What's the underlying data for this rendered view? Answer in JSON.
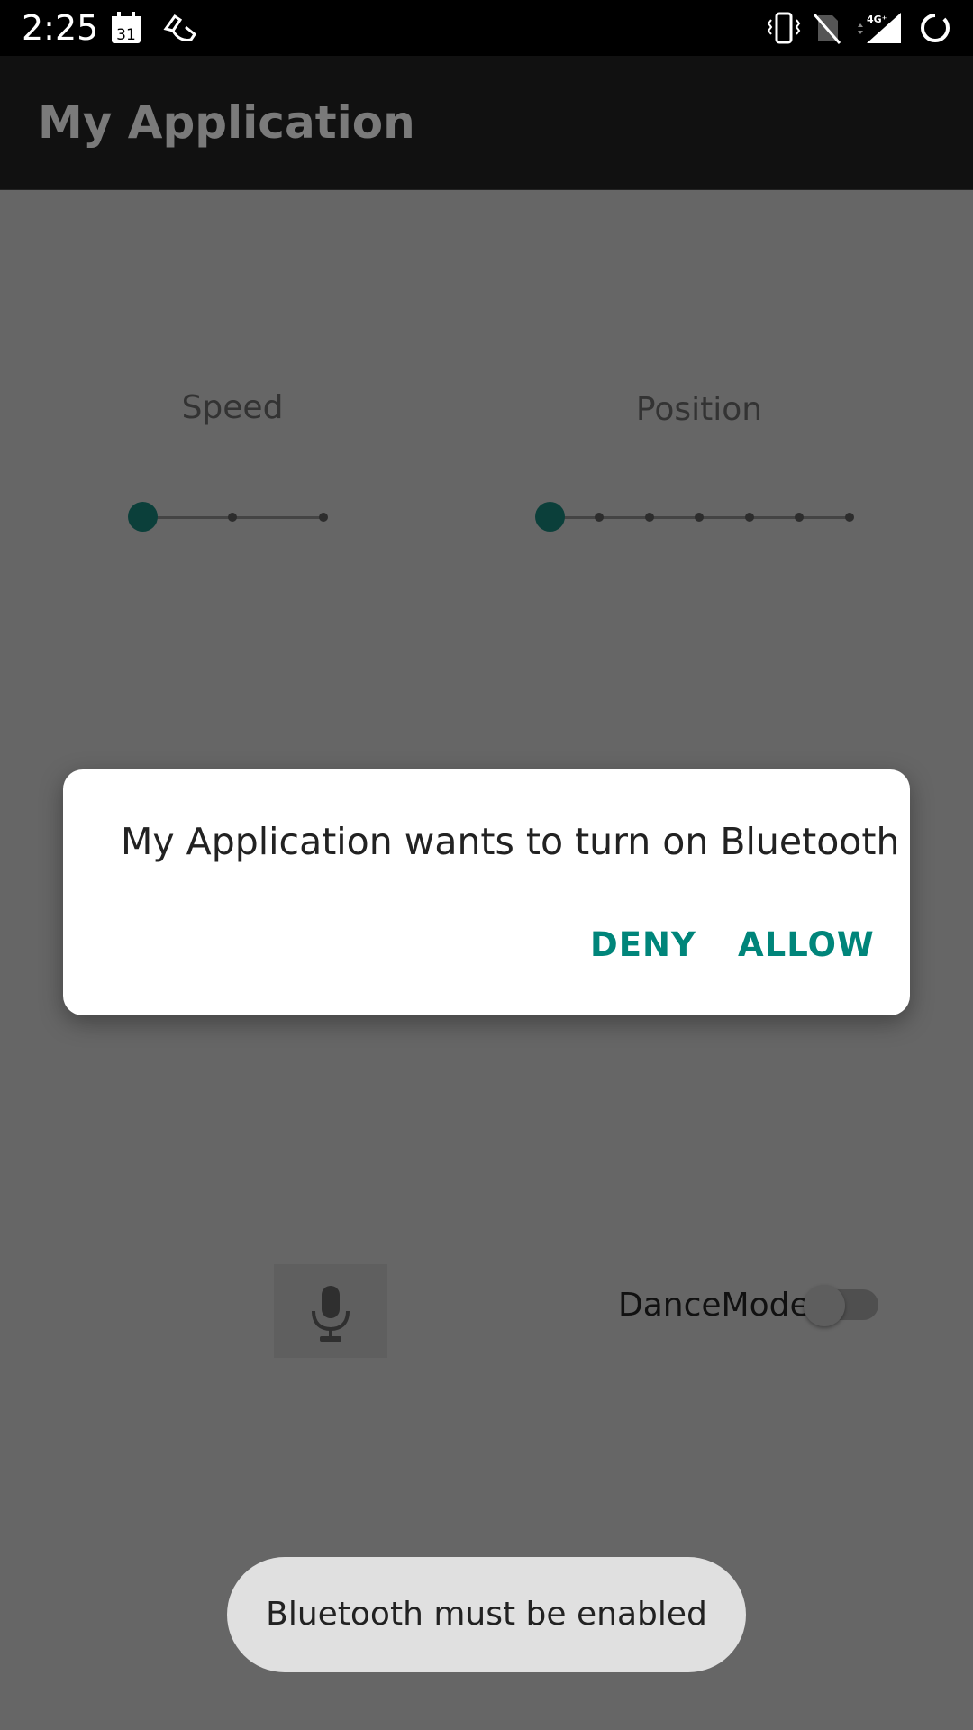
{
  "status_bar": {
    "time": "2:25",
    "calendar_day": "31",
    "network": "4G⁺"
  },
  "app_bar": {
    "title": "My Application"
  },
  "controls": {
    "speed": {
      "label": "Speed",
      "value": 0,
      "steps": 3
    },
    "position": {
      "label": "Position",
      "value": 0,
      "steps": 7
    },
    "dance_mode": {
      "label": "DanceMode",
      "on": false
    }
  },
  "dialog": {
    "message": "My Application wants to turn on Bluetooth",
    "deny_label": "DENY",
    "allow_label": "ALLOW"
  },
  "toast": {
    "text": "Bluetooth must be enabled"
  },
  "colors": {
    "accent": "#00857a",
    "slider_thumb": "#0b3f3a",
    "scrim": "#666666"
  }
}
